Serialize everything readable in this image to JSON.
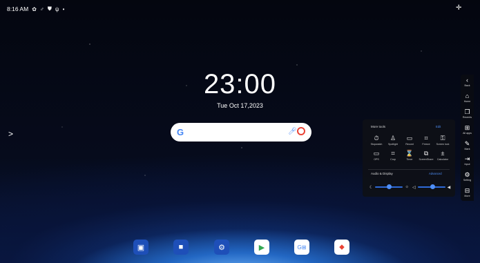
{
  "status_bar": {
    "time": "8:16 AM",
    "icons": [
      "gear-icon",
      "usb-icon",
      "shield-icon",
      "usb-symbol-icon",
      "dot-icon"
    ]
  },
  "clock": {
    "time": "23:00",
    "date": "Tue Oct 17,2023"
  },
  "search": {
    "logo": "G"
  },
  "sidebar": {
    "items": [
      {
        "label": "Back",
        "icon": "chevron-left-icon"
      },
      {
        "label": "Home",
        "icon": "home-icon"
      },
      {
        "label": "Recents",
        "icon": "recents-icon"
      },
      {
        "label": "All apps",
        "icon": "grid-icon"
      },
      {
        "label": "Mark",
        "icon": "pen-icon"
      },
      {
        "label": "Input",
        "icon": "input-icon"
      },
      {
        "label": "Setting",
        "icon": "gear-icon"
      },
      {
        "label": "More",
        "icon": "more-icon"
      }
    ]
  },
  "more_tools": {
    "title": "More tools",
    "edit_label": "Edit",
    "tools": [
      {
        "label": "Stopwatch",
        "icon": "stopwatch-icon"
      },
      {
        "label": "Spotlight",
        "icon": "spotlight-icon"
      },
      {
        "label": "Record",
        "icon": "record-icon"
      },
      {
        "label": "Freeze",
        "icon": "freeze-icon"
      },
      {
        "label": "Screen lock",
        "icon": "lock-icon"
      },
      {
        "label": "OPS",
        "icon": "monitor-icon"
      },
      {
        "label": "Crop",
        "icon": "crop-icon"
      },
      {
        "label": "Timer",
        "icon": "hourglass-icon"
      },
      {
        "label": "ScreenShare",
        "icon": "screenshare-icon"
      },
      {
        "label": "Calculator",
        "icon": "calculator-icon"
      }
    ]
  },
  "audio_display": {
    "title": "Audio & Display",
    "advanced_label": "Advanced",
    "brightness_level": 0.5,
    "volume_level": 0.55
  },
  "dock": {
    "apps": [
      {
        "name": "presentation-app-icon",
        "color": "#1e4fb8"
      },
      {
        "name": "files-app-icon",
        "color": "#1e4fb8"
      },
      {
        "name": "settings-app-icon",
        "color": "#1e4fb8"
      },
      {
        "name": "play-store-icon",
        "color": "#ffffff"
      },
      {
        "name": "google-apps-icon",
        "color": "#ffffff"
      },
      {
        "name": "maps-icon",
        "color": "#ffffff"
      }
    ]
  }
}
